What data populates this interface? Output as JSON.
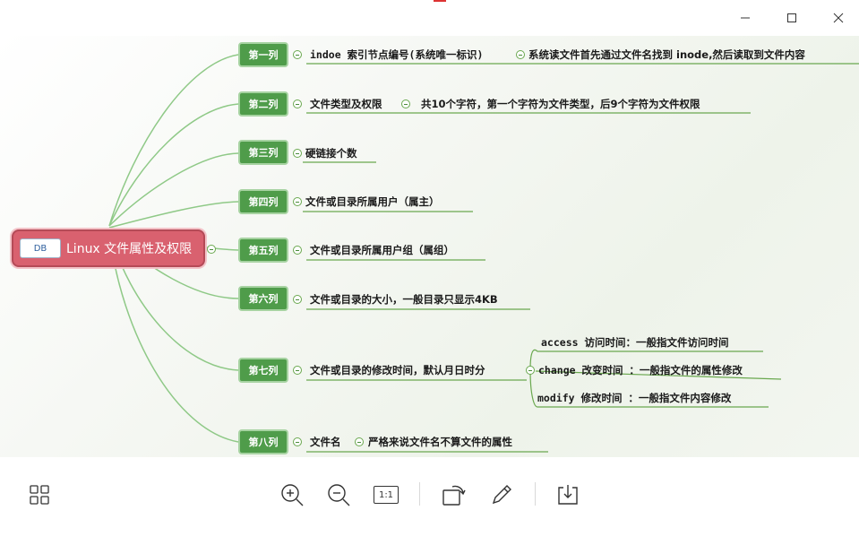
{
  "window": {
    "minimize_icon": "minimize-icon",
    "maximize_icon": "maximize-icon",
    "close_icon": "close-icon"
  },
  "mindmap": {
    "root": {
      "logo_text": "DB",
      "label": "Linux 文件属性及权限",
      "color": "#d9616f"
    },
    "branch_color": "#4f9c4a",
    "columns": [
      {
        "label": "第一列",
        "detail": "indoe 索引节点编号(系统唯一标识)",
        "detail2": "系统读文件首先通过文件名找到 inode,然后读取到文件内容"
      },
      {
        "label": "第二列",
        "detail": "文件类型及权限",
        "detail2": "共10个字符，第一个字符为文件类型，后9个字符为文件权限"
      },
      {
        "label": "第三列",
        "detail": "硬链接个数"
      },
      {
        "label": "第四列",
        "detail": "文件或目录所属用户（属主）"
      },
      {
        "label": "第五列",
        "detail": "文件或目录所属用户组（属组）"
      },
      {
        "label": "第六列",
        "detail": "文件或目录的大小，一般目录只显示4KB"
      },
      {
        "label": "第七列",
        "detail": "文件或目录的修改时间，默认月日时分",
        "subitems": [
          "access 访问时间：一般指文件访问时间",
          "change 改变时间 ：一般指文件的属性修改",
          "modify 修改时间 ：一般指文件内容修改"
        ]
      },
      {
        "label": "第八列",
        "detail": "文件名",
        "detail2": "严格来说文件名不算文件的属性"
      }
    ]
  },
  "toolbar": {
    "icons": [
      "grid-view-icon",
      "zoom-in-icon",
      "zoom-out-icon",
      "actual-size-icon",
      "rotate-icon",
      "edit-icon",
      "save-icon"
    ],
    "actual_size_label": "1:1"
  }
}
